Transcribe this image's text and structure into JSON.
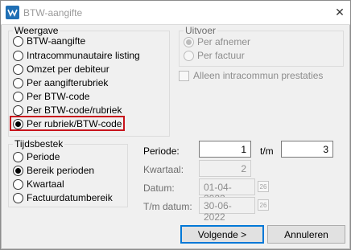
{
  "window": {
    "title": "BTW-aangifte"
  },
  "weergave": {
    "legend": "Weergave",
    "options": [
      {
        "label": "BTW-aangifte",
        "checked": false
      },
      {
        "label": "Intracommunautaire listing",
        "checked": false
      },
      {
        "label": "Omzet per debiteur",
        "checked": false
      },
      {
        "label": "Per aangifterubriek",
        "checked": false
      },
      {
        "label": "Per BTW-code",
        "checked": false
      },
      {
        "label": "Per BTW-code/rubriek",
        "checked": false
      },
      {
        "label": "Per rubriek/BTW-code",
        "checked": true
      }
    ]
  },
  "uitvoer": {
    "legend": "Uitvoer",
    "options": [
      {
        "label": "Per afnemer",
        "checked": true
      },
      {
        "label": "Per factuur",
        "checked": false
      }
    ],
    "checkbox_label": "Alleen intracommun prestaties"
  },
  "tijdsbestek": {
    "legend": "Tijdsbestek",
    "options": [
      {
        "label": "Periode",
        "checked": false
      },
      {
        "label": "Bereik perioden",
        "checked": true
      },
      {
        "label": "Kwartaal",
        "checked": false
      },
      {
        "label": "Factuurdatumbereik",
        "checked": false
      }
    ]
  },
  "fields": {
    "periode_label": "Periode:",
    "periode_from": "1",
    "tm_label": "t/m",
    "periode_to": "3",
    "kwartaal_label": "Kwartaal:",
    "kwartaal_value": "2",
    "datum_label": "Datum:",
    "datum_value": "01-04-2022",
    "tm_datum_label": "T/m datum:",
    "tm_datum_value": "30-06-2022",
    "calendar_day": "26"
  },
  "buttons": {
    "next": "Volgende >",
    "cancel": "Annuleren"
  },
  "colors": {
    "highlight": "#c8141c",
    "default_button_border": "#0078d7"
  }
}
